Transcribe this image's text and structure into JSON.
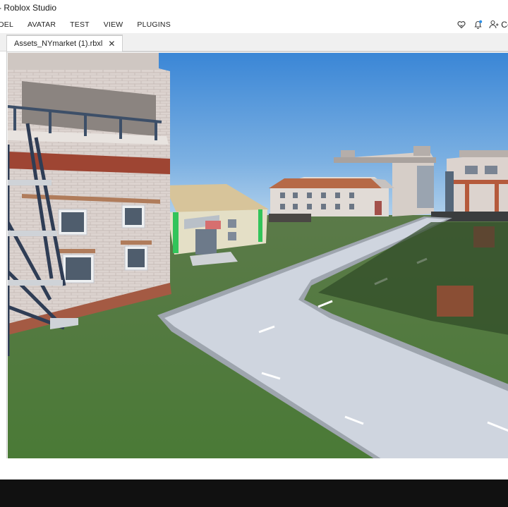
{
  "window": {
    "title": "- Roblox Studio"
  },
  "ribbon": {
    "items": [
      "DEL",
      "AVATAR",
      "TEST",
      "VIEW",
      "PLUGINS"
    ],
    "collab_label": "Co"
  },
  "tabs": [
    {
      "label": "Assets_NYmarket (1).rbxl",
      "active": true
    }
  ],
  "icons": {
    "heart": "heart-icon",
    "notifications": "bell-icon",
    "collaborate": "collaborate-icon",
    "close_tab": "close-icon"
  },
  "colors": {
    "sky_top": "#3f8bd8",
    "sky_bottom": "#b7d3ea",
    "grass": "#4f7a3c",
    "road": "#c9d2df",
    "taskbar": "#111111"
  }
}
